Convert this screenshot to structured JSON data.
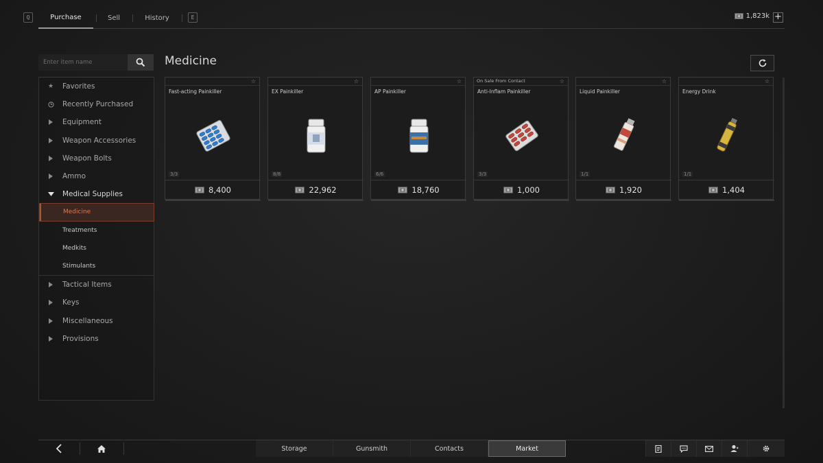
{
  "topnav": {
    "left_key": "Q",
    "right_key": "E",
    "tabs": [
      {
        "label": "Purchase",
        "active": true
      },
      {
        "label": "Sell",
        "active": false
      },
      {
        "label": "History",
        "active": false
      }
    ],
    "currency_amount": "1,823k",
    "add_label": "+"
  },
  "search": {
    "placeholder": "Enter item name",
    "icon": "search-icon"
  },
  "sidebar": {
    "items": [
      {
        "label": "Favorites",
        "icon": "star-icon"
      },
      {
        "label": "Recently Purchased",
        "icon": "clock-icon"
      },
      {
        "label": "Equipment",
        "icon": "chevron-right-icon"
      },
      {
        "label": "Weapon Accessories",
        "icon": "chevron-right-icon"
      },
      {
        "label": "Weapon Bolts",
        "icon": "chevron-right-icon"
      },
      {
        "label": "Ammo",
        "icon": "chevron-right-icon"
      },
      {
        "label": "Medical Supplies",
        "icon": "chevron-down-icon"
      }
    ],
    "sub_items": [
      "Medicine",
      "Treatments",
      "Medkits",
      "Stimulants"
    ],
    "active_sub": "Medicine",
    "lower_items": [
      {
        "label": "Tactical Items",
        "icon": "chevron-right-icon"
      },
      {
        "label": "Keys",
        "icon": "chevron-right-icon"
      },
      {
        "label": "Miscellaneous",
        "icon": "chevron-right-icon"
      },
      {
        "label": "Provisions",
        "icon": "chevron-right-icon"
      }
    ]
  },
  "main": {
    "title": "Medicine",
    "refresh_icon": "refresh-icon",
    "items": [
      {
        "name": "Fast-acting Painkiller",
        "banner": "",
        "stock": "3/3",
        "price": "8,400",
        "image": "blister-pack-blue"
      },
      {
        "name": "EX Painkiller",
        "banner": "",
        "stock": "8/8",
        "price": "22,962",
        "image": "pill-bottle-white"
      },
      {
        "name": "AP Painkiller",
        "banner": "",
        "stock": "6/6",
        "price": "18,760",
        "image": "pill-bottle-blue"
      },
      {
        "name": "Anti-Inflam Painkiller",
        "banner": "On Sale From Contact",
        "stock": "3/3",
        "price": "1,000",
        "image": "blister-pack-red"
      },
      {
        "name": "Liquid Painkiller",
        "banner": "",
        "stock": "1/1",
        "price": "1,920",
        "image": "tube-red"
      },
      {
        "name": "Energy Drink",
        "banner": "",
        "stock": "1/1",
        "price": "1,404",
        "image": "vial-yellow"
      }
    ]
  },
  "bottombar": {
    "back_icon": "back-arrow-icon",
    "home_icon": "home-icon",
    "tabs": [
      {
        "label": "Storage",
        "active": false
      },
      {
        "label": "Gunsmith",
        "active": false
      },
      {
        "label": "Contacts",
        "active": false
      },
      {
        "label": "Market",
        "active": true
      }
    ],
    "right_icons": [
      "notes-icon",
      "chat-icon",
      "mail-icon",
      "profile-icon",
      "settings-icon"
    ]
  },
  "colors": {
    "accent": "#b5522f",
    "accent_text": "#d87a55",
    "background": "#1e1e1e"
  }
}
